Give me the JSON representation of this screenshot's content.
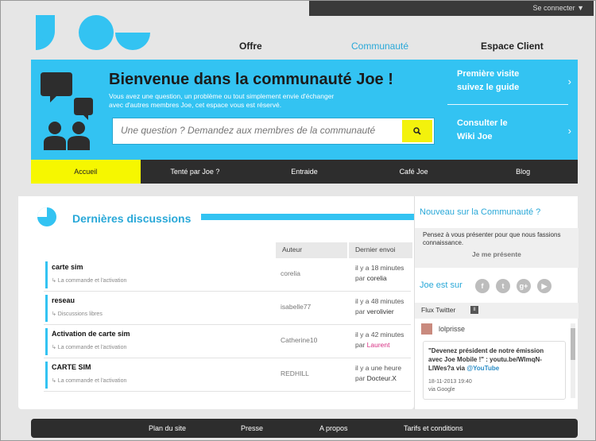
{
  "topbar": {
    "connect_label": "Se connecter ▼"
  },
  "nav": {
    "offre": "Offre",
    "communaute": "Communauté",
    "espace_client": "Espace Client"
  },
  "hero": {
    "title": "Bienvenue dans la communauté Joe !",
    "subtitle": "Vous avez une question, un problème ou tout simplement envie d'échanger avec d'autres membres Joe, cet espace vous est réservé.",
    "search_placeholder": "Une question ? Demandez aux membres de la communauté",
    "side_links": [
      {
        "line1": "Première visite",
        "line2": "suivez le guide"
      },
      {
        "line1": "Consulter le",
        "line2": "Wiki Joe"
      }
    ],
    "arrow": "›"
  },
  "subnav": [
    "Accueil",
    "Tenté par Joe ?",
    "Entraide",
    "Café Joe",
    "Blog"
  ],
  "discussions": {
    "title": "Dernières discussions",
    "col_author": "Auteur",
    "col_last": "Dernier envoi",
    "rows": [
      {
        "title": "carte sim",
        "category": "↳ La commande et l'activation",
        "author": "corelia",
        "when": "il y a 18 minutes",
        "by_prefix": "par ",
        "by": "corelia"
      },
      {
        "title": "reseau",
        "category": "↳ Discussions libres",
        "author": "isabelle77",
        "when": "il y a 48 minutes",
        "by_prefix": "par ",
        "by": "verolivier"
      },
      {
        "title": "Activation de carte sim",
        "category": "↳ La commande et l'activation",
        "author": "Catherine10",
        "when": "il y a 42 minutes",
        "by_prefix": "par ",
        "by": "Laurent"
      },
      {
        "title": "CARTE SIM",
        "category": "↳ La commande et l'activation",
        "author": "REDHILL",
        "when": "il y a une heure",
        "by_prefix": "par ",
        "by": "Docteur.X"
      }
    ]
  },
  "sidebar": {
    "new_title": "Nouveau sur la Communauté ?",
    "new_text": "Pensez à vous présenter pour que nous fassions connaissance.",
    "new_link": "Je me présente",
    "social_label": "Joe est sur",
    "social": [
      "f",
      "t",
      "g+",
      "▶"
    ],
    "flux_label": "Flux Twitter",
    "pause": "II",
    "tweet_user": "lolprisse",
    "tweet_text_1": "\"Devenez président de notre émission avec Joe Mobile !\" : youtu.be/WlmqN-LlWes?a via ",
    "tweet_link": "@YouTube",
    "tweet_date": "18-11-2013 19:40",
    "tweet_via": "via Google"
  },
  "footer": [
    "Plan du site",
    "Presse",
    "A propos",
    "Tarifs et conditions"
  ],
  "colors": {
    "accent": "#33c3f2",
    "highlight": "#f6f700",
    "dark": "#2d2d2d"
  }
}
